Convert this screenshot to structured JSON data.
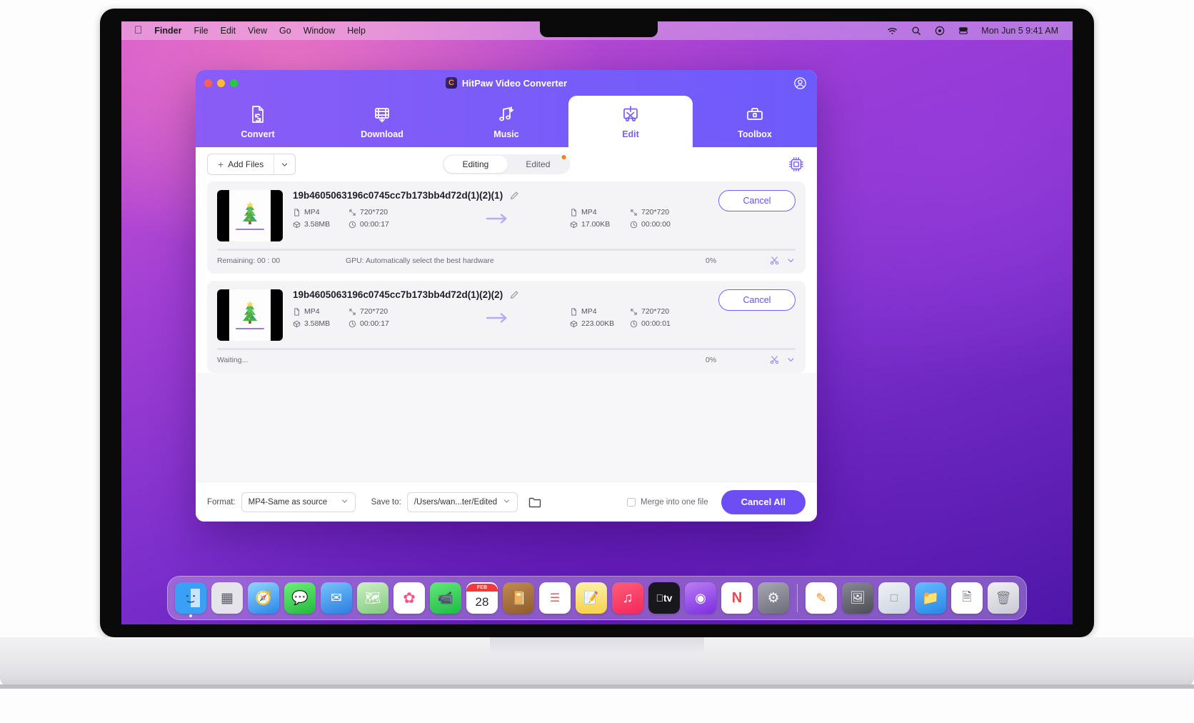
{
  "menubar": {
    "apple": "",
    "items": [
      "Finder",
      "File",
      "Edit",
      "View",
      "Go",
      "Window",
      "Help"
    ],
    "status_icons": [
      "wifi-icon",
      "search-icon",
      "control-center-icon",
      "battery-icon"
    ],
    "time": "Mon Jun 5  9:41 AM"
  },
  "window": {
    "title": "HitPaw Video Converter",
    "logo_letter": "C",
    "traffic_lights": [
      "close",
      "minimize",
      "zoom"
    ],
    "account_icon": "account-icon"
  },
  "nav": {
    "tabs": [
      {
        "label": "Convert",
        "icon": "convert-icon",
        "active": false
      },
      {
        "label": "Download",
        "icon": "download-icon",
        "active": false
      },
      {
        "label": "Music",
        "icon": "music-icon",
        "active": false
      },
      {
        "label": "Edit",
        "icon": "edit-icon",
        "active": true
      },
      {
        "label": "Toolbox",
        "icon": "toolbox-icon",
        "active": false
      }
    ]
  },
  "toolbar": {
    "add_files_label": "Add Files",
    "add_files_dropdown_icon": "chevron-down-icon",
    "settings_icon": "settings-gpu-icon",
    "segments": [
      {
        "label": "Editing",
        "active": true,
        "badge": false
      },
      {
        "label": "Edited",
        "active": false,
        "badge": true
      }
    ]
  },
  "files": [
    {
      "name": "19b4605063196c0745cc7b173bb4d72d(1)(2)(1)",
      "source": {
        "format": "MP4",
        "resolution": "720*720",
        "size": "3.58MB",
        "duration": "00:00:17"
      },
      "output": {
        "format": "MP4",
        "resolution": "720*720",
        "size": "17.00KB",
        "duration": "00:00:00"
      },
      "action_label": "Cancel",
      "status": "Remaining: 00 : 00",
      "gpu": "GPU: Automatically select the best hardware",
      "percent": "0%",
      "progress": 0
    },
    {
      "name": "19b4605063196c0745cc7b173bb4d72d(1)(2)(2)",
      "source": {
        "format": "MP4",
        "resolution": "720*720",
        "size": "3.58MB",
        "duration": "00:00:17"
      },
      "output": {
        "format": "MP4",
        "resolution": "720*720",
        "size": "223.00KB",
        "duration": "00:00:01"
      },
      "action_label": "Cancel",
      "status": "Waiting...",
      "gpu": "",
      "percent": "0%",
      "progress": 0
    }
  ],
  "bottombar": {
    "format_label": "Format:",
    "format_value": "MP4-Same as source",
    "saveto_label": "Save to:",
    "saveto_value": "/Users/wan...ter/Edited",
    "folder_icon": "folder-open-icon",
    "merge_label": "Merge into one file",
    "merge_checked": false,
    "cancel_all_label": "Cancel All"
  },
  "dock": {
    "items": [
      {
        "name": "finder",
        "glyph": "🙂",
        "color": "#3aa0f5",
        "running": true
      },
      {
        "name": "launchpad",
        "glyph": "⌸",
        "color": "#d8d8de",
        "running": false
      },
      {
        "name": "safari",
        "glyph": "🧭",
        "color": "#2ea8f0",
        "running": false
      },
      {
        "name": "messages",
        "glyph": "💬",
        "color": "#4ad45f",
        "running": false
      },
      {
        "name": "mail",
        "glyph": "✉",
        "color": "#3d9bf5",
        "running": false
      },
      {
        "name": "maps",
        "glyph": "🗺",
        "color": "#7ed77e",
        "running": false
      },
      {
        "name": "photos",
        "glyph": "✿",
        "color": "#fdfdfd",
        "running": false
      },
      {
        "name": "facetime",
        "glyph": "📹",
        "color": "#3fcf5a",
        "running": false
      },
      {
        "name": "calendar",
        "glyph": "28",
        "color": "#ffffff",
        "running": false
      },
      {
        "name": "contacts",
        "glyph": "📔",
        "color": "#b5773d",
        "running": false
      },
      {
        "name": "reminders",
        "glyph": "☰",
        "color": "#ffffff",
        "running": false
      },
      {
        "name": "notes",
        "glyph": "📝",
        "color": "#fbe07a",
        "running": false
      },
      {
        "name": "music",
        "glyph": "♫",
        "color": "#fa4f66",
        "running": false
      },
      {
        "name": "appletv",
        "glyph": "tv",
        "color": "#17171c",
        "running": false
      },
      {
        "name": "podcasts",
        "glyph": "◉",
        "color": "#8b4ff0",
        "running": false
      },
      {
        "name": "news",
        "glyph": "N",
        "color": "#ffffff",
        "running": false
      },
      {
        "name": "settings",
        "glyph": "⚙",
        "color": "#7c7c88",
        "running": false
      },
      {
        "name": "pages",
        "glyph": "✎",
        "color": "#ffffff",
        "running": false
      },
      {
        "name": "screenshot",
        "glyph": "🖼",
        "color": "#5c5c68",
        "running": false
      },
      {
        "name": "preview",
        "glyph": "□",
        "color": "#dfe3ea",
        "running": false
      },
      {
        "name": "downloads",
        "glyph": "📁",
        "color": "#3aa0f5",
        "running": false
      },
      {
        "name": "documents",
        "glyph": "📄",
        "color": "#e7e7ed",
        "running": false
      },
      {
        "name": "trash",
        "glyph": "🗑",
        "color": "#d6d6de",
        "running": false
      }
    ]
  }
}
